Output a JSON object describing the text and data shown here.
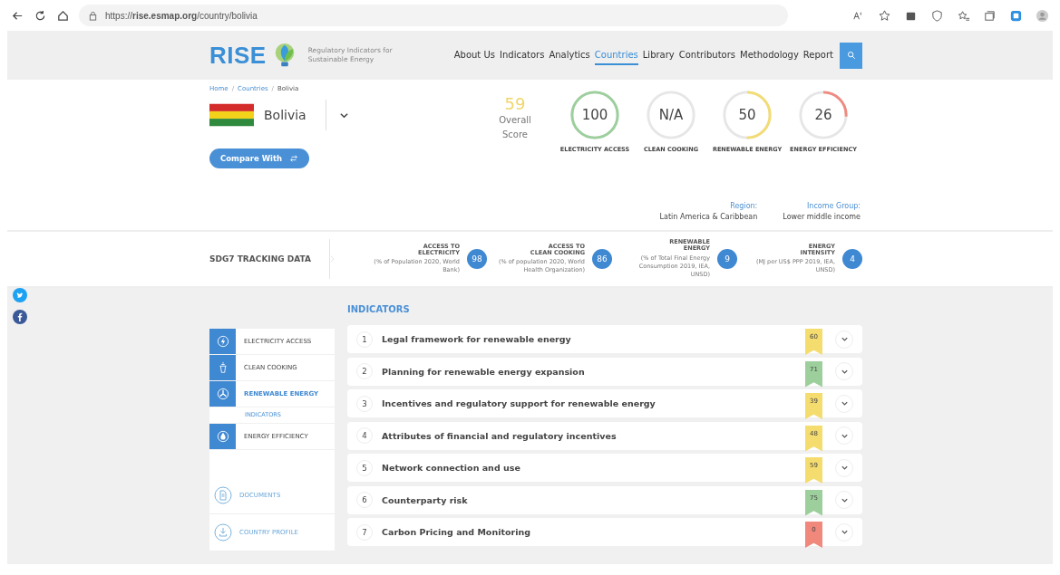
{
  "browser": {
    "url": "https://**rise.esmap.org**/country/bolivia"
  },
  "header": {
    "logo": "RISE",
    "tagline": "Regulatory Indicators for Sustainable Energy",
    "nav": [
      {
        "label": "About Us",
        "selected": false
      },
      {
        "label": "Indicators",
        "selected": false
      },
      {
        "label": "Analytics",
        "selected": false
      },
      {
        "label": "Countries",
        "selected": true
      },
      {
        "label": "Library",
        "selected": false
      },
      {
        "label": "Contributors",
        "selected": false
      },
      {
        "label": "Methodology",
        "selected": false
      },
      {
        "label": "Report",
        "selected": false
      }
    ]
  },
  "breadcrumb": {
    "items": [
      "Home",
      "Countries",
      "Bolivia"
    ],
    "separator": "/"
  },
  "country": {
    "name": "Bolivia",
    "compare_button": "Compare With"
  },
  "overall": {
    "score": "59",
    "label": "Overall Score"
  },
  "pillars": [
    {
      "value": "100",
      "label": "ELECTRICITY ACCESS"
    },
    {
      "value": "N/A",
      "label": "CLEAN COOKING"
    },
    {
      "value": "50",
      "label": "RENEWABLE ENERGY"
    },
    {
      "value": "26",
      "label": "ENERGY EFFICIENCY"
    }
  ],
  "region": {
    "label": "Region:",
    "value": "Latin America & Caribbean"
  },
  "income_group": {
    "label": "Income Group:",
    "value": "Lower middle income"
  },
  "sdg": {
    "title": "SDG7 TRACKING DATA",
    "items": [
      {
        "title": "ACCESS TO ELECTRICITY",
        "note": "(% of Population 2020, World Bank)",
        "value": "98"
      },
      {
        "title": "ACCESS TO CLEAN COOKING",
        "note": "(% of population 2020, World Health Organization)",
        "value": "86"
      },
      {
        "title": "RENEWABLE ENERGY",
        "note": "(% of Total Final Energy Consumption 2019, IEA, UNSD)",
        "value": "9"
      },
      {
        "title": "ENERGY INTENSITY",
        "note": "(MJ per US$ PPP 2019, IEA, UNSD)",
        "value": "4"
      }
    ]
  },
  "social": [
    {
      "kind": "twitter"
    },
    {
      "kind": "facebook"
    }
  ],
  "sidebar": {
    "items": [
      {
        "label": "ELECTRICITY ACCESS",
        "kind": "electricity",
        "selected": false
      },
      {
        "label": "CLEAN COOKING",
        "kind": "cooking",
        "selected": false
      },
      {
        "label": "RENEWABLE ENERGY",
        "kind": "renewable",
        "selected": true,
        "children": [
          {
            "label": "INDICATORS",
            "selected": true
          }
        ]
      },
      {
        "label": "ENERGY EFFICIENCY",
        "kind": "efficiency",
        "selected": false
      }
    ],
    "links": [
      {
        "label": "DOCUMENTS",
        "kind": "document"
      },
      {
        "label": "COUNTRY PROFILE",
        "kind": "download"
      }
    ]
  },
  "indicators": {
    "title": "INDICATORS",
    "rows": [
      {
        "number": "1",
        "title": "Legal framework for renewable energy",
        "score": "60",
        "color": "#f5dc6e",
        "expanded": false
      },
      {
        "number": "2",
        "title": "Planning for renewable energy expansion",
        "score": "71",
        "color": "#9ccf9c",
        "expanded": false
      },
      {
        "number": "3",
        "title": "Incentives and regulatory support for renewable energy",
        "score": "39",
        "color": "#f5dc6e",
        "expanded": false
      },
      {
        "number": "4",
        "title": "Attributes of financial and regulatory incentives",
        "score": "48",
        "color": "#f5dc6e",
        "expanded": false
      },
      {
        "number": "5",
        "title": "Network connection and use",
        "score": "59",
        "color": "#f5dc6e",
        "expanded": false
      },
      {
        "number": "6",
        "title": "Counterparty risk",
        "score": "75",
        "color": "#9ccf9c",
        "expanded": false
      },
      {
        "number": "7",
        "title": "Carbon Pricing and Monitoring",
        "score": "0",
        "color": "#f0887c",
        "expanded": false
      }
    ]
  }
}
